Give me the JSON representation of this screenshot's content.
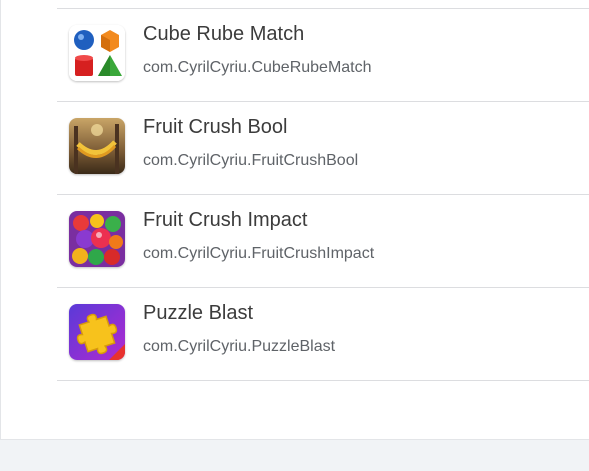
{
  "apps": [
    {
      "name": "Cube Rube Match",
      "package": "com.CyrilCyriu.CubeRubeMatch",
      "icon": "cube-rube-match-icon"
    },
    {
      "name": "Fruit Crush Bool",
      "package": "com.CyrilCyriu.FruitCrushBool",
      "icon": "fruit-crush-bool-icon"
    },
    {
      "name": "Fruit Crush Impact",
      "package": "com.CyrilCyriu.FruitCrushImpact",
      "icon": "fruit-crush-impact-icon"
    },
    {
      "name": "Puzzle Blast",
      "package": "com.CyrilCyriu.PuzzleBlast",
      "icon": "puzzle-blast-icon"
    }
  ]
}
